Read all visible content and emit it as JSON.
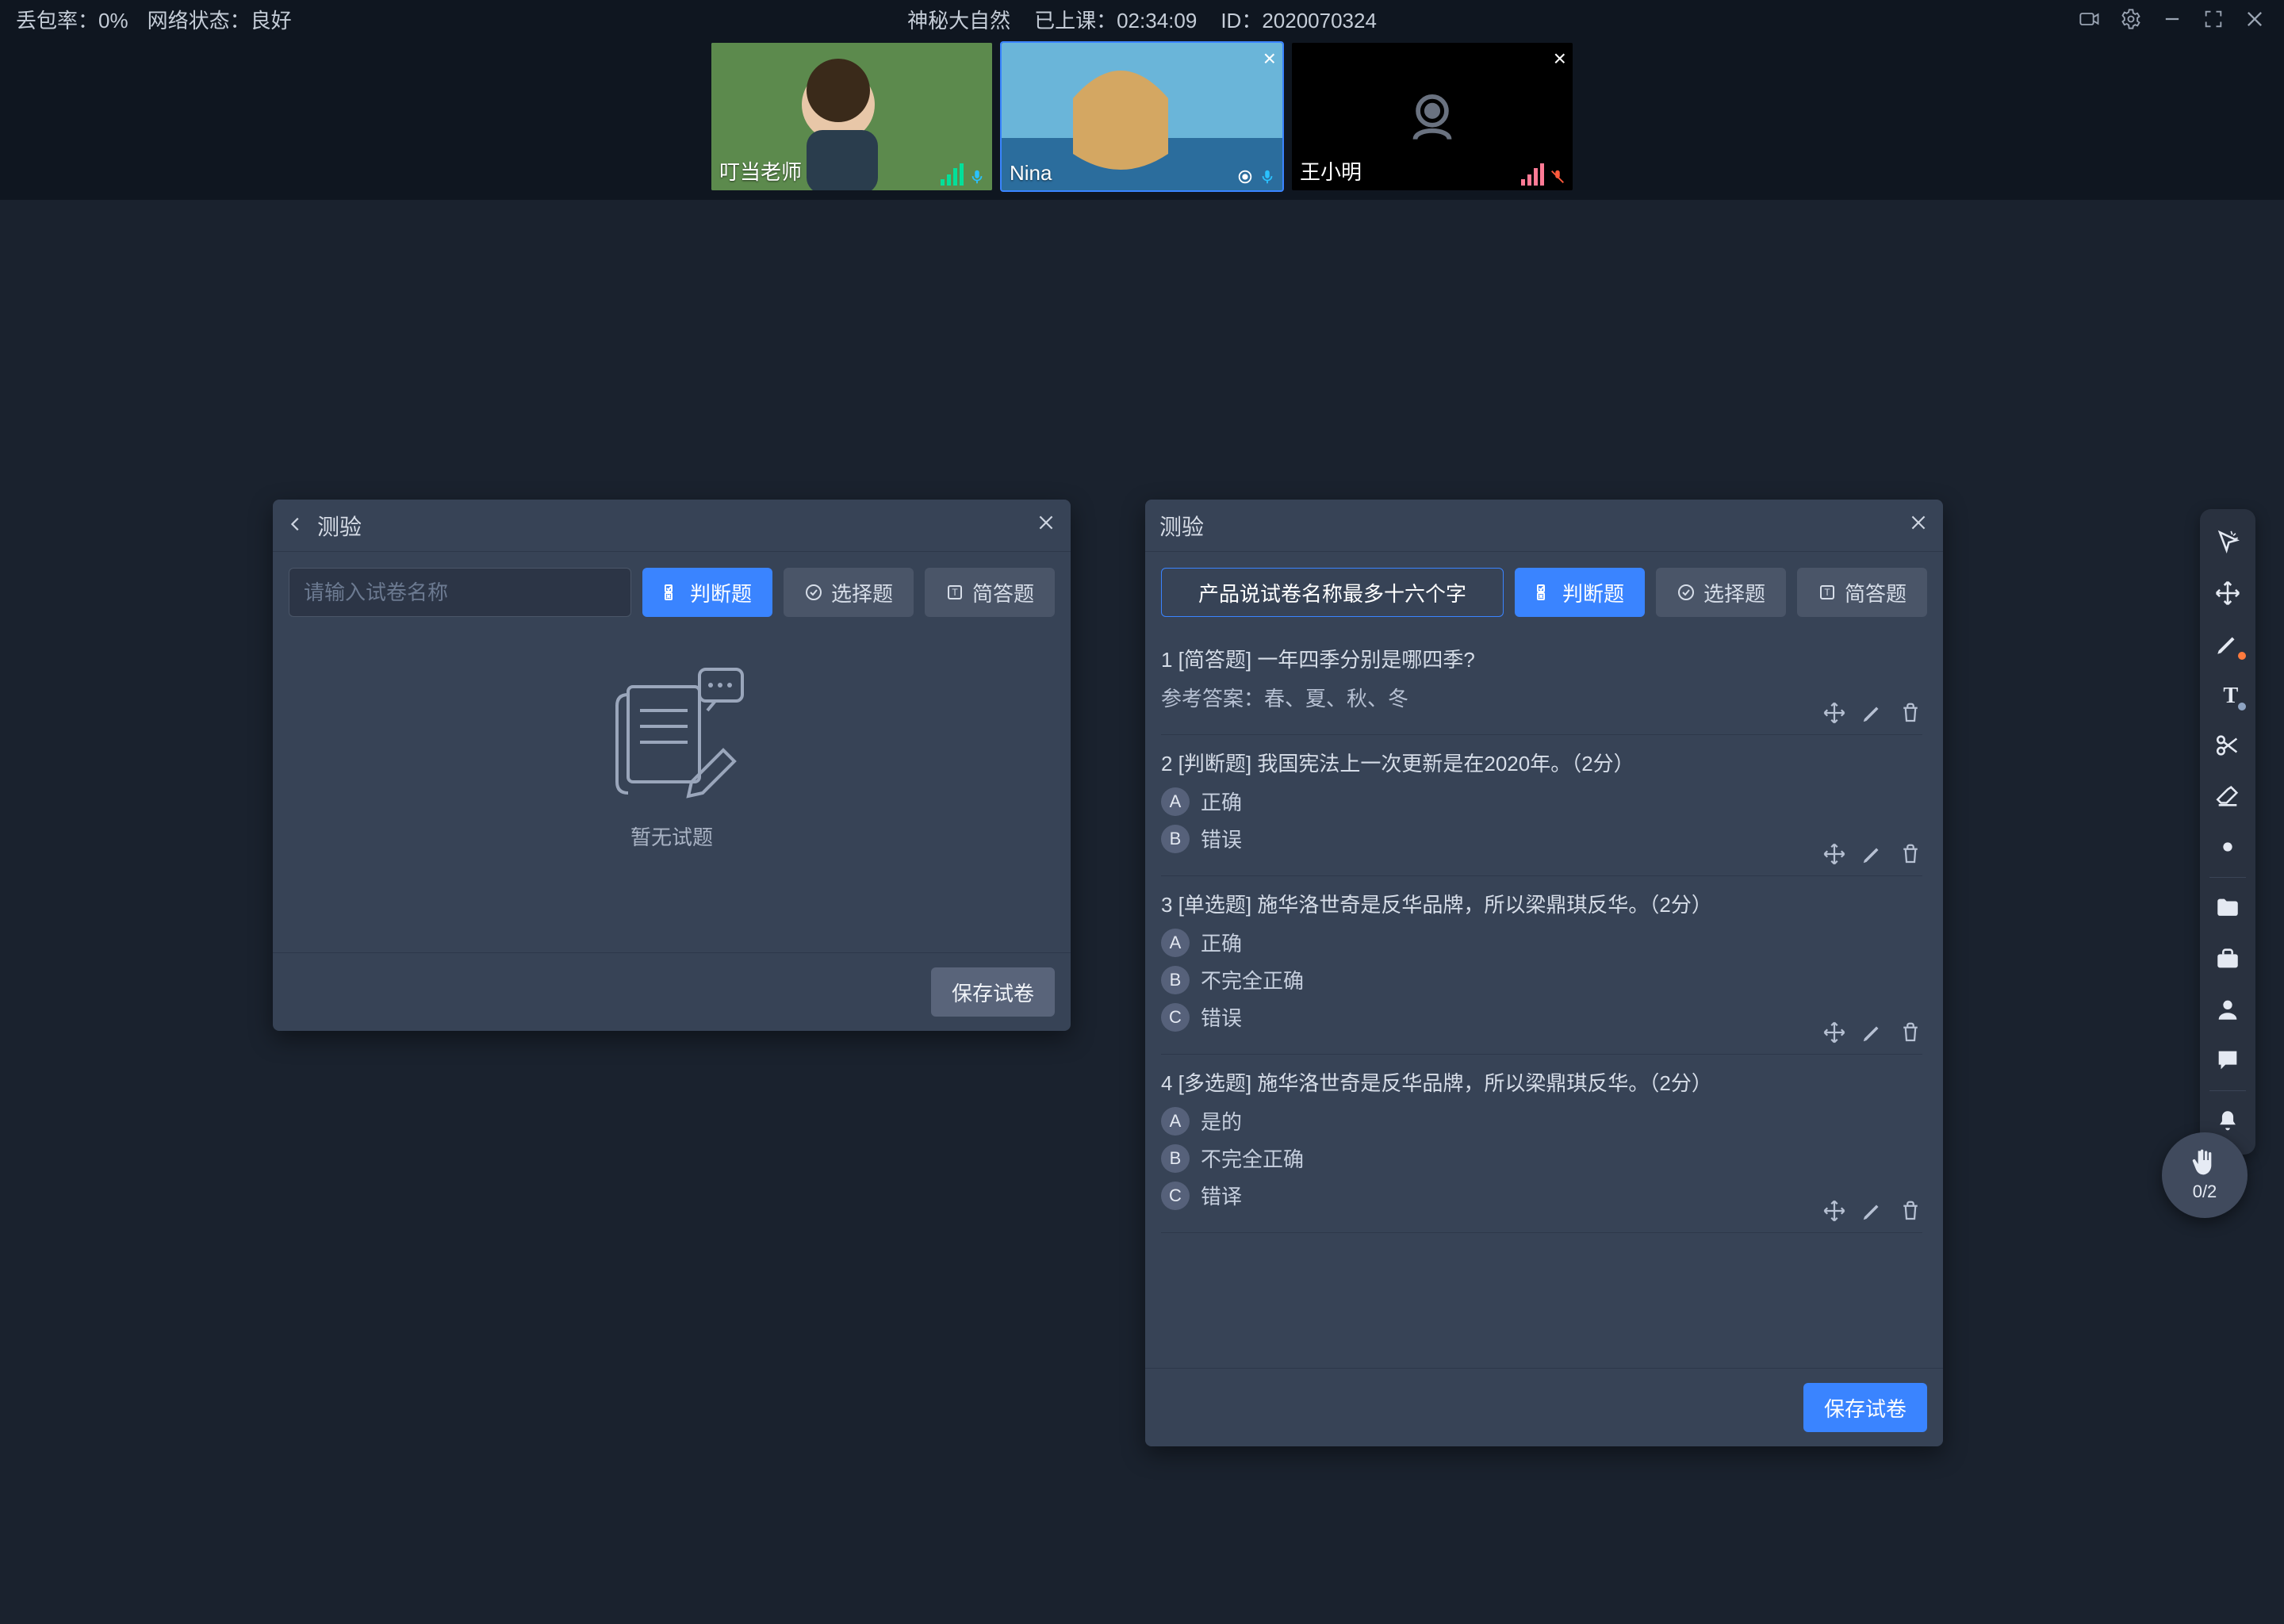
{
  "titlebar": {
    "packet_loss_label": "丢包率：0%",
    "network_label": "网络状态：良好",
    "course_title": "神秘大自然",
    "elapsed_label": "已上课：02:34:09",
    "session_id_label": "ID：2020070324"
  },
  "participants": [
    {
      "name": "叮当老师",
      "camera": "on",
      "mic": "on",
      "signal": true,
      "bg": "teacher"
    },
    {
      "name": "Nina",
      "camera": "on",
      "mic": "on",
      "signal": false,
      "closeable": true,
      "bg": "nina",
      "active": true
    },
    {
      "name": "王小明",
      "camera": "off",
      "mic": "off",
      "signal": true,
      "closeable": true,
      "bg": "off"
    }
  ],
  "panel_empty": {
    "title": "测验",
    "placeholder": "请输入试卷名称",
    "btns": {
      "judge": "判断题",
      "choice": "选择题",
      "short": "简答题"
    },
    "empty_text": "暂无试题",
    "save": "保存试卷"
  },
  "panel_quiz": {
    "title": "测验",
    "name_input": "产品说试卷名称最多十六个字",
    "btns": {
      "judge": "判断题",
      "choice": "选择题",
      "short": "简答题"
    },
    "save": "保存试卷",
    "ref_prefix": "参考答案：",
    "questions": [
      {
        "idx": "1",
        "tag": "[简答题]",
        "text": "一年四季分别是哪四季?",
        "reference": "春、夏、秋、冬",
        "options": []
      },
      {
        "idx": "2",
        "tag": "[判断题]",
        "text": "我国宪法上一次更新是在2020年。（2分）",
        "options": [
          {
            "k": "A",
            "v": "正确"
          },
          {
            "k": "B",
            "v": "错误"
          }
        ]
      },
      {
        "idx": "3",
        "tag": "[单选题]",
        "text": "施华洛世奇是反华品牌，所以梁鼎琪反华。（2分）",
        "options": [
          {
            "k": "A",
            "v": "正确"
          },
          {
            "k": "B",
            "v": "不完全正确"
          },
          {
            "k": "C",
            "v": "错误"
          }
        ]
      },
      {
        "idx": "4",
        "tag": "[多选题]",
        "text": "施华洛世奇是反华品牌，所以梁鼎琪反华。（2分）",
        "options": [
          {
            "k": "A",
            "v": "是的"
          },
          {
            "k": "B",
            "v": "不完全正确"
          },
          {
            "k": "C",
            "v": "错译"
          }
        ]
      }
    ]
  },
  "toolbar_icons": [
    "cursor-icon",
    "move-icon",
    "pen-icon",
    "text-icon",
    "scissors-icon",
    "eraser-icon",
    "dot-icon",
    "sep",
    "folder-icon",
    "toolbox-icon",
    "users-icon",
    "chat-icon",
    "sep",
    "bell-icon"
  ],
  "hand": {
    "count": "0/2"
  }
}
